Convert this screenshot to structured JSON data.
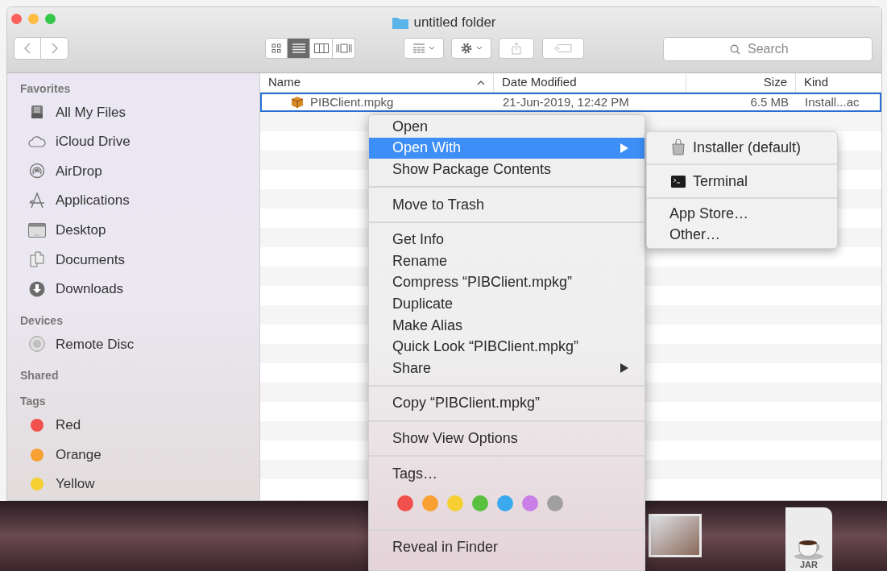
{
  "window": {
    "title": "untitled folder"
  },
  "toolbar": {
    "view_modes": [
      {
        "selected": false
      },
      {
        "selected": true
      },
      {
        "selected": false
      },
      {
        "selected": false
      }
    ],
    "search": {
      "placeholder": "Search"
    }
  },
  "sidebar": {
    "sections": [
      {
        "title": "Favorites",
        "items": [
          {
            "label": "All My Files",
            "kind": "place"
          },
          {
            "label": "iCloud Drive",
            "kind": "place"
          },
          {
            "label": "AirDrop",
            "kind": "place"
          },
          {
            "label": "Applications",
            "kind": "place"
          },
          {
            "label": "Desktop",
            "kind": "place"
          },
          {
            "label": "Documents",
            "kind": "place"
          },
          {
            "label": "Downloads",
            "kind": "place"
          }
        ]
      },
      {
        "title": "Devices",
        "items": [
          {
            "label": "Remote Disc",
            "kind": "place"
          }
        ]
      },
      {
        "title": "Shared"
      },
      {
        "title": "Tags",
        "items": [
          {
            "label": "Red",
            "kind": "tag",
            "color": "#f2504c"
          },
          {
            "label": "Orange",
            "kind": "tag",
            "color": "#f8a031"
          },
          {
            "label": "Yellow",
            "kind": "tag",
            "color": "#f6d033"
          }
        ]
      }
    ]
  },
  "table": {
    "columns": [
      {
        "label": "Name",
        "sorted": true
      },
      {
        "label": "Date Modified",
        "sorted": false
      },
      {
        "label": "Size",
        "sorted": false
      },
      {
        "label": "Kind",
        "sorted": false
      }
    ],
    "rows": [
      {
        "name": "PIBClient.mpkg",
        "date": "21-Jun-2019, 12:42 PM",
        "size": "6.5 MB",
        "kind": "Install...ac",
        "selected": true
      }
    ]
  },
  "context_menu": {
    "items": [
      {
        "kind": "item",
        "label": "Open",
        "selected": false,
        "submenu": false
      },
      {
        "kind": "item",
        "label": "Open With",
        "selected": true,
        "submenu": true
      },
      {
        "kind": "item",
        "label": "Show Package Contents",
        "selected": false,
        "submenu": false
      },
      {
        "kind": "separator"
      },
      {
        "kind": "item",
        "label": "Move to Trash",
        "selected": false,
        "submenu": false
      },
      {
        "kind": "separator"
      },
      {
        "kind": "item",
        "label": "Get Info",
        "selected": false,
        "submenu": false
      },
      {
        "kind": "item",
        "label": "Rename",
        "selected": false,
        "submenu": false
      },
      {
        "kind": "item",
        "label": "Compress “PIBClient.mpkg”",
        "selected": false,
        "submenu": false
      },
      {
        "kind": "item",
        "label": "Duplicate",
        "selected": false,
        "submenu": false
      },
      {
        "kind": "item",
        "label": "Make Alias",
        "selected": false,
        "submenu": false
      },
      {
        "kind": "item",
        "label": "Quick Look “PIBClient.mpkg”",
        "selected": false,
        "submenu": false
      },
      {
        "kind": "item",
        "label": "Share",
        "selected": false,
        "submenu": true
      },
      {
        "kind": "separator"
      },
      {
        "kind": "item",
        "label": "Copy “PIBClient.mpkg”",
        "selected": false,
        "submenu": false
      },
      {
        "kind": "separator"
      },
      {
        "kind": "item",
        "label": "Show View Options",
        "selected": false,
        "submenu": false
      },
      {
        "kind": "separator"
      },
      {
        "kind": "item",
        "label": "Tags…",
        "selected": false,
        "submenu": false
      },
      {
        "kind": "tags",
        "colors": [
          {
            "color": "#f2504c"
          },
          {
            "color": "#f8a031"
          },
          {
            "color": "#f6d033"
          },
          {
            "color": "#5ac03f"
          },
          {
            "color": "#3aa9ef"
          },
          {
            "color": "#c97fe6"
          },
          {
            "color": "#a0a0a0"
          }
        ]
      },
      {
        "kind": "separator"
      },
      {
        "kind": "item",
        "label": "Reveal in Finder",
        "selected": false,
        "submenu": false
      }
    ]
  },
  "submenu": {
    "items": [
      {
        "kind": "app",
        "label": "Installer (default)"
      },
      {
        "kind": "separator"
      },
      {
        "kind": "app",
        "label": "Terminal"
      },
      {
        "kind": "separator"
      },
      {
        "kind": "item",
        "label": "App Store…"
      },
      {
        "kind": "item",
        "label": "Other…"
      }
    ]
  },
  "desktop": {
    "icons": [
      {
        "kind": "screenshot"
      },
      {
        "kind": "file",
        "label": "JAR"
      }
    ]
  }
}
